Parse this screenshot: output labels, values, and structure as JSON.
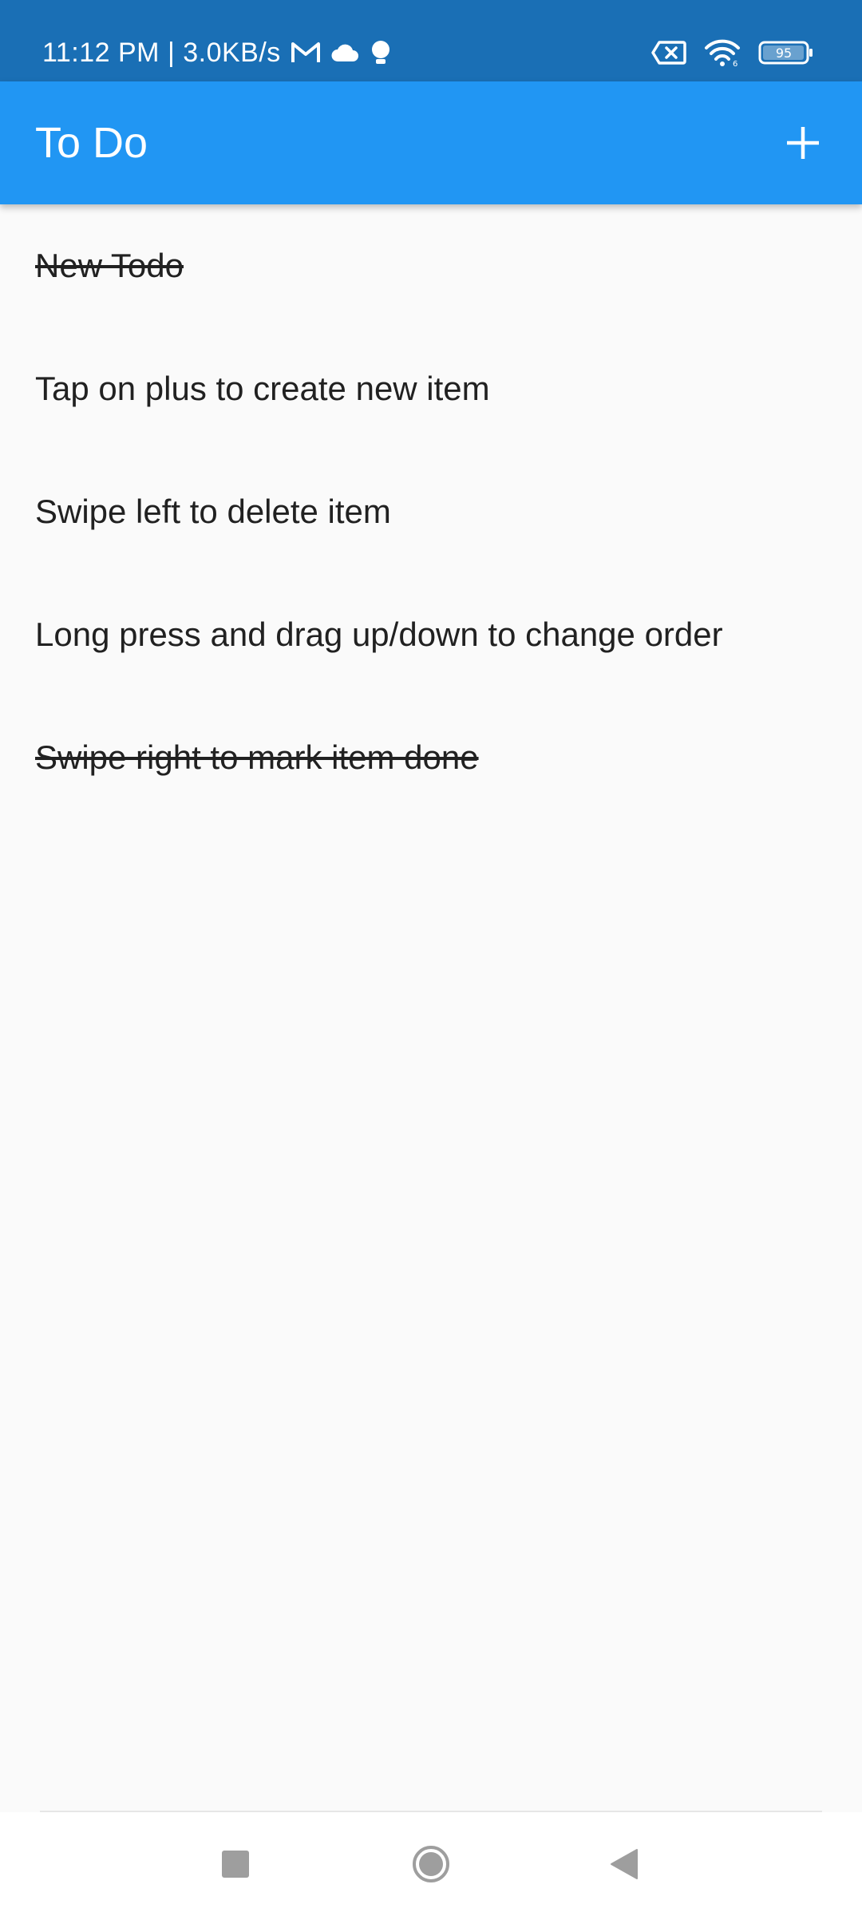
{
  "status_bar": {
    "time_speed": "11:12 PM | 3.0KB/s",
    "battery_level": "95",
    "icons": [
      "gmail-icon",
      "cloud-icon",
      "notification-icon",
      "no-sim-icon",
      "wifi-icon",
      "battery-icon"
    ]
  },
  "app_bar": {
    "title": "To Do",
    "add_icon": "plus-icon"
  },
  "todos": [
    {
      "text": "New Todo",
      "done": true
    },
    {
      "text": "Tap on plus to create new item",
      "done": false
    },
    {
      "text": "Swipe left to delete item",
      "done": false
    },
    {
      "text": "Long press and drag up/down to change order",
      "done": false
    },
    {
      "text": "Swipe right to mark item done",
      "done": true
    }
  ],
  "nav_bar": {
    "icons": [
      "recents-icon",
      "home-icon",
      "back-icon"
    ]
  },
  "colors": {
    "status_bar": "#1a6fb5",
    "app_bar": "#2196f3",
    "background": "#fafafa",
    "text": "#212121",
    "nav_icon": "#9e9e9e"
  }
}
